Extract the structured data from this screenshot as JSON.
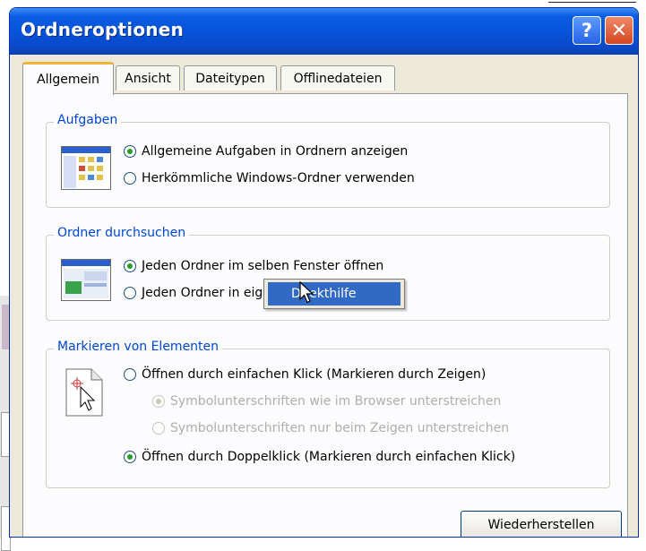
{
  "window": {
    "title": "Ordneroptionen",
    "help_label": "?",
    "close_label": "✕"
  },
  "tabs": [
    {
      "label": "Allgemein",
      "active": true
    },
    {
      "label": "Ansicht",
      "active": false
    },
    {
      "label": "Dateitypen",
      "active": false
    },
    {
      "label": "Offlinedateien",
      "active": false
    }
  ],
  "groups": {
    "tasks": {
      "title": "Aufgaben",
      "options": [
        {
          "label": "Allgemeine Aufgaben in Ordnern anzeigen",
          "checked": true
        },
        {
          "label": "Herkömmliche Windows-Ordner verwenden",
          "checked": false
        }
      ]
    },
    "browse": {
      "title": "Ordner durchsuchen",
      "options": [
        {
          "label": "Jeden Ordner im selben Fenster öffnen",
          "checked": true
        },
        {
          "label": "Jeden Ordner in eigenem Fenster öffnen",
          "checked": false
        }
      ]
    },
    "select": {
      "title": "Markieren von Elementen",
      "options": [
        {
          "label": "Öffnen durch einfachen Klick (Markieren durch Zeigen)",
          "checked": false
        },
        {
          "label": "Symbolunterschriften wie im Browser unterstreichen",
          "checked": true,
          "disabled": true
        },
        {
          "label": "Symbolunterschriften nur beim Zeigen unterstreichen",
          "checked": false,
          "disabled": true
        },
        {
          "label": "Öffnen durch Doppelklick (Markieren durch einfachen Klick)",
          "checked": true
        }
      ]
    }
  },
  "buttons": {
    "restore": "Wiederherstellen"
  },
  "context_menu": {
    "item": "Direkthilfe"
  },
  "colors": {
    "titlebar": "#0752d8",
    "group_title": "#0046d5",
    "tab_highlight": "#f2b33d",
    "menu_highlight": "#316ac5",
    "radio_dot": "#21a121"
  }
}
